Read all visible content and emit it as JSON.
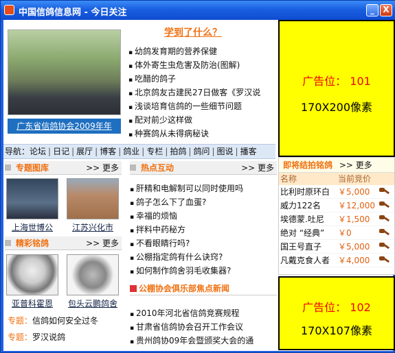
{
  "window": {
    "title": "中国信鸽信息网 - 今日关注",
    "minimize_label": "_",
    "close_label": "X"
  },
  "photo": {
    "caption": "广东省信鸽协会2009年年"
  },
  "learn": {
    "title": "学到了什么？",
    "items": [
      "幼鸽发育期的营养保健",
      "体外寄生虫危害及防治(图解)",
      "吃醋的鸽子",
      "北京鸽友古建民27日做客《罗汉说",
      "浅谈培育信鸽的一些细节问题",
      "配对前少这样做",
      "种赛鸽从未得病秘诀"
    ]
  },
  "nav": {
    "label": "导航：",
    "items": [
      "论坛",
      "日记",
      "展厅",
      "博客",
      "鸽业",
      "专栏",
      "拍鸽",
      "鸽问",
      "图说",
      "播客"
    ]
  },
  "topics_gallery": {
    "title": "专题图库",
    "more": ">> 更多",
    "items": [
      {
        "caption": "上海世博公"
      },
      {
        "caption": "江苏兴化市"
      }
    ]
  },
  "famous_pigeons": {
    "title": "精彩铭鸽",
    "more": ">> 更多",
    "items": [
      {
        "caption": "亚普科霍恩"
      },
      {
        "caption": "包头云鹏鸽舍"
      }
    ]
  },
  "topics": [
    {
      "key": "专题：",
      "text": "信鸽如何安全过冬"
    },
    {
      "key": "专题：",
      "text": "罗汉说鸽"
    }
  ],
  "hot": {
    "title": "热点互动",
    "more": ">> 更多",
    "items": [
      "肝精和电解制可以同时使用吗",
      "鸽子怎么下了血蛋?",
      "幸福的烦恼",
      "拌料中药秘方",
      "不看眼睛行吗?",
      "公棚指定鸽有什么诀窍?",
      "如何制作鸽舍羽毛收集器?"
    ]
  },
  "news": {
    "title": "公棚协会俱乐部焦点新闻",
    "items": [
      "2010年河北省信鸽竞赛规程",
      "甘肃省信鸽协会召开工作会议",
      "贵州鸽协09年会暨颁奖大会的通"
    ]
  },
  "ad1": {
    "line1": "广告位： 101",
    "line2": "170X200像素"
  },
  "ad2": {
    "line1": "广告位： 102",
    "line2": "170X107像素"
  },
  "auction": {
    "title": "即将结拍铭鸽",
    "more": ">> 更多",
    "col_name": "名称",
    "col_price": "当前竞价",
    "rows": [
      {
        "name": "比利时原环白",
        "price": "￥5,000"
      },
      {
        "name": "威力122名",
        "price": "￥12,000"
      },
      {
        "name": "埃德蒙.吐尼",
        "price": "￥1,500"
      },
      {
        "name": "绝对 “经典”",
        "price": "￥0"
      },
      {
        "name": "国王号直子",
        "price": "￥5,000"
      },
      {
        "name": "凡戴克食人者",
        "price": "￥4,000"
      }
    ]
  },
  "colors": {
    "accent": "#f07010",
    "link_caption_bg": "#1e6fc0",
    "ad_bg": "#ffff00",
    "title_bar": "#1a5fe0"
  }
}
